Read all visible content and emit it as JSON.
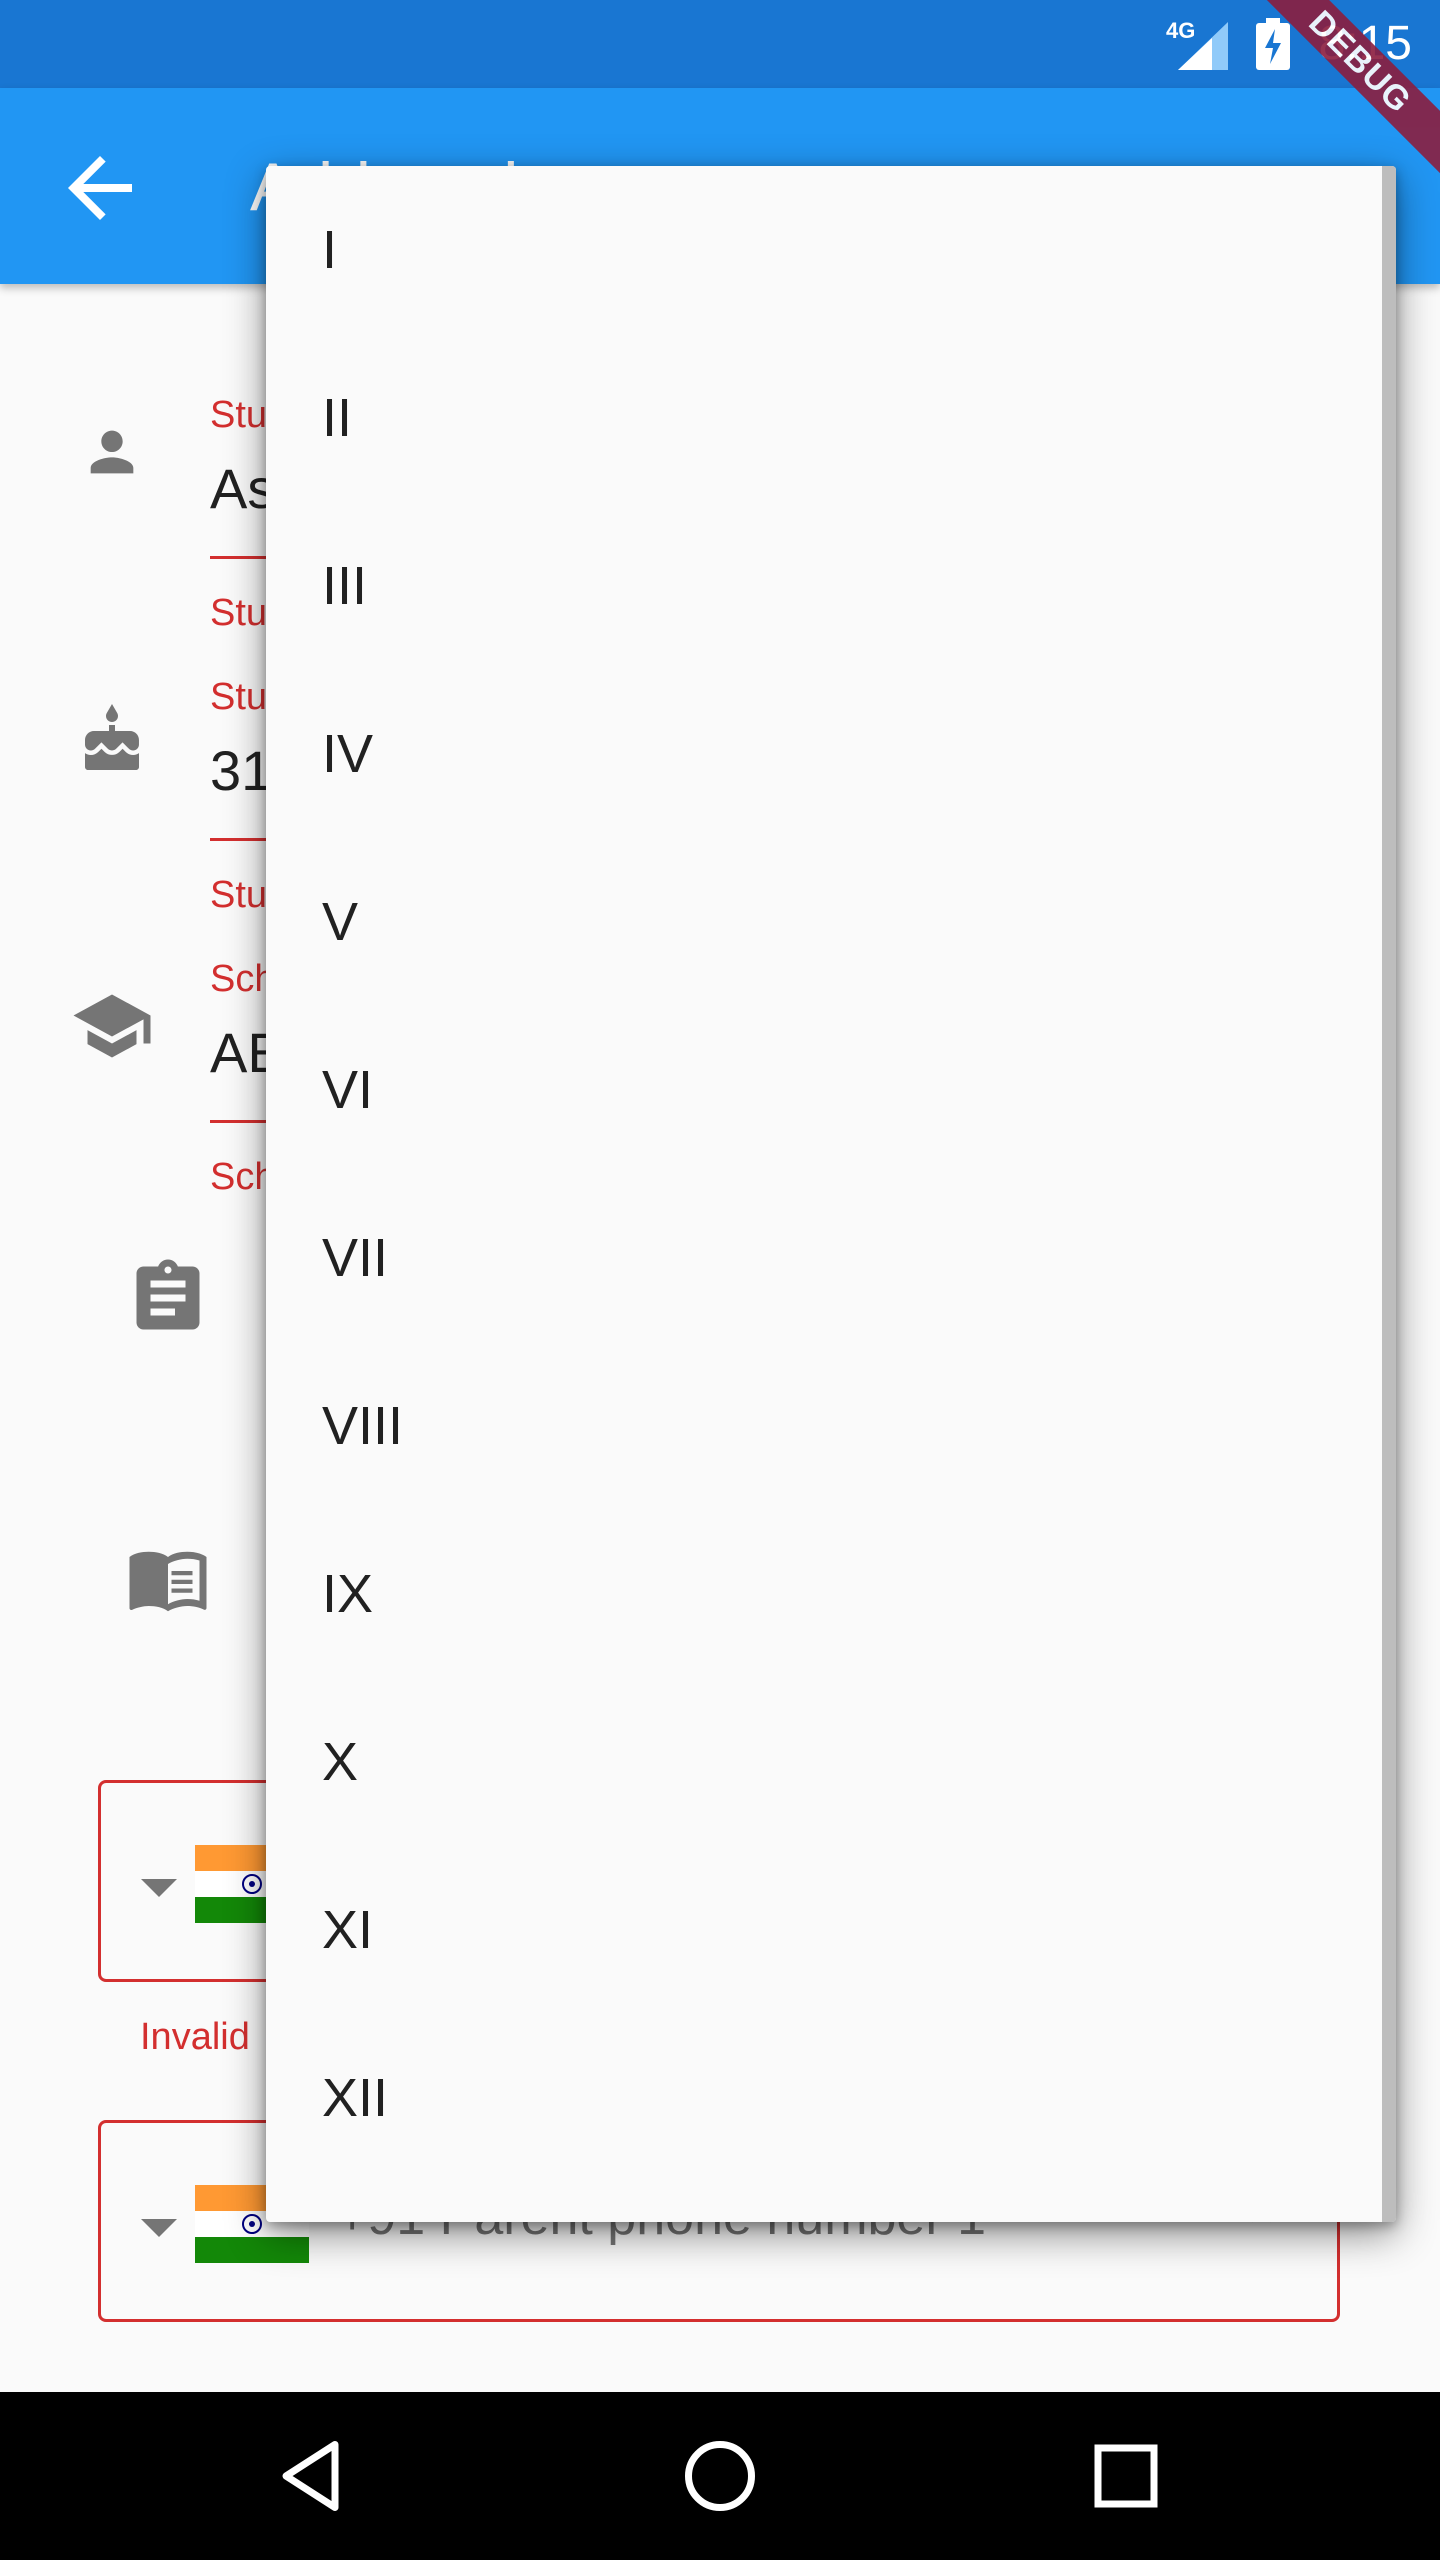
{
  "status_bar": {
    "time": "8:15",
    "network": "4G",
    "debug_label": "DEBUG"
  },
  "app_bar": {
    "title": "Add student",
    "back_icon": "arrow-back-icon"
  },
  "form": {
    "name_label": "Stu",
    "name_value": "As",
    "name_error": "Stu",
    "dob_label": "Stu",
    "dob_value": "31",
    "dob_error": "Stu",
    "school_label": "Sch",
    "school_value": "AE",
    "school_error": "Sch",
    "phone1_error": "Invalid",
    "phone2_placeholder": "+91  Parent phone number 1",
    "clear_symbol": "×"
  },
  "class_menu": {
    "items": [
      "I",
      "II",
      "III",
      "IV",
      "V",
      "VI",
      "VII",
      "VIII",
      "IX",
      "X",
      "XI",
      "XII"
    ]
  },
  "icons": {
    "person": "person-icon",
    "cake": "cake-icon",
    "school": "school-icon",
    "assignment": "assignment-icon",
    "book": "book-icon"
  },
  "colors": {
    "app_bar": "#2196f3",
    "status_bar": "#1976d2",
    "error": "#d32f2f",
    "debug": "#8b1e3f"
  }
}
